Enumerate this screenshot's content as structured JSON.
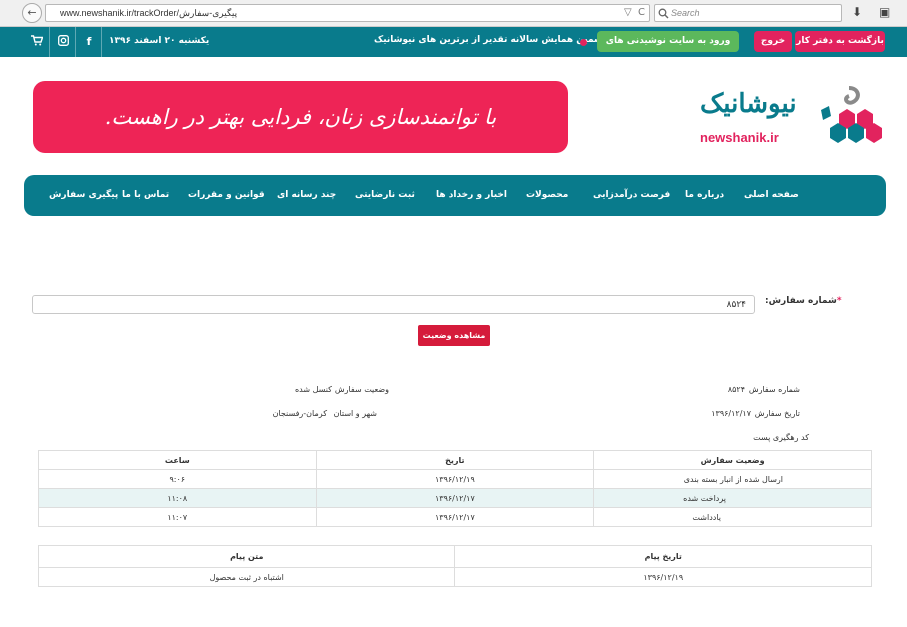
{
  "browser": {
    "url": "www.newshanik.ir/trackOrder/پیگیری-سفارش",
    "search_placeholder": "Search",
    "back_icon": "←",
    "reload_icon": "C",
    "dropdown_icon": "▽",
    "download_icon": "⬇",
    "reader_icon": "▣"
  },
  "topbar": {
    "date": "یکشنبه ۲۰ اسفند ۱۳۹۶",
    "facebook_icon": "f",
    "instagram_icon": "◘",
    "cart_icon": "🛒",
    "news": "ششمین همایش سالانه تقدیر از برترین های نیوشانیک",
    "btn_green": "ورود به سایت نوشیدنی های نیوشا",
    "btn_exit": "خروج",
    "btn_office": "بازگشت به دفتر کار"
  },
  "header": {
    "banner_text": "با توانمندسازی زنان، فردایی بهتر در راهست.",
    "logo_word": "نیوشانیک",
    "logo_url": "newshanik.ir"
  },
  "nav": {
    "home": "صفحه اصلی",
    "about": "درباره ما",
    "income": "فرصت درآمدزایی",
    "products": "محصولات",
    "news": "اخبار و رخداد ها",
    "complaint": "ثبت نارضایتی",
    "media": "چند رسانه ای",
    "rules": "قوانین و مقررات",
    "contact": "تماس با ما",
    "tracking": "پیگیری سفارش"
  },
  "form": {
    "label": "شماره سفارش:",
    "required_mark": "*",
    "value": "۸۵۲۴",
    "button": "مشاهده وضعیت"
  },
  "info": {
    "order_no_label": "شماره سفارش",
    "order_no_value": "۸۵۲۴",
    "status_label": "وضعیت سفارش",
    "status_value": "کنسل شده",
    "date_label": "تاریخ سفارش",
    "date_value": "۱۳۹۶/۱۲/۱۷",
    "city_label": "شهر و استان",
    "city_value": "کرمان-رفسنجان",
    "tracking_label": "کد رهگیری پست"
  },
  "status_table": {
    "headers": [
      "وضعیت سفارش",
      "تاریخ",
      "ساعت"
    ],
    "rows": [
      [
        "ارسال شده از انبار بسته بندی",
        "۱۳۹۶/۱۲/۱۹",
        "۹:۰۶"
      ],
      [
        "پرداخت شده",
        "۱۳۹۶/۱۲/۱۷",
        "۱۱:۰۸"
      ],
      [
        "یادداشت",
        "۱۳۹۶/۱۲/۱۷",
        "۱۱:۰۷"
      ]
    ]
  },
  "message_table": {
    "headers": [
      "تاریخ پیام",
      "متن پیام"
    ],
    "rows": [
      [
        "۱۳۹۶/۱۲/۱۹",
        "اشتباه در ثبت محصول"
      ]
    ]
  },
  "colors": {
    "teal": "#097b8c",
    "pink": "#ee2456",
    "red_button": "#d51b3b",
    "green_button": "#5cb85c"
  }
}
